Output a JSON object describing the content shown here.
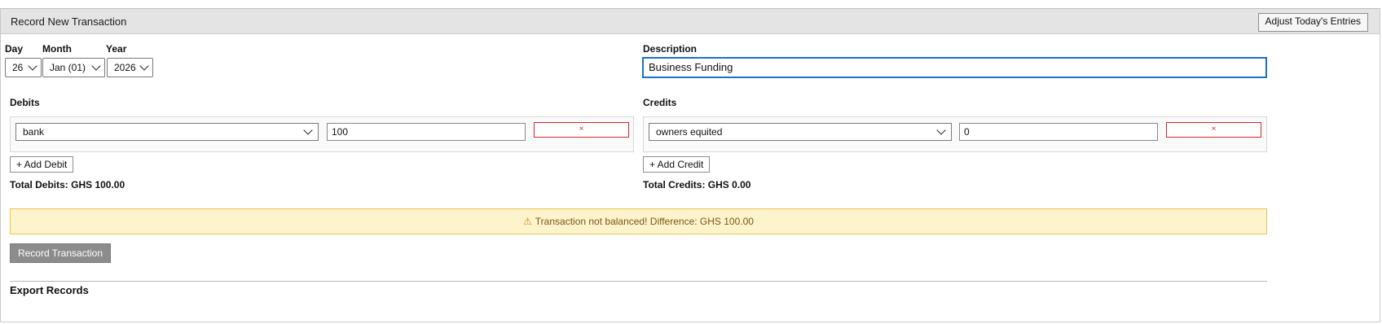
{
  "panel": {
    "title": "Record New Transaction",
    "adjust_button": "Adjust Today's Entries"
  },
  "date": {
    "day_label": "Day",
    "month_label": "Month",
    "year_label": "Year",
    "day_value": "26",
    "month_value": "Jan (01)",
    "year_value": "2026"
  },
  "description": {
    "label": "Description",
    "value": "Business Funding"
  },
  "debits": {
    "title": "Debits",
    "entries": [
      {
        "account": "bank",
        "amount": "100",
        "remove_symbol": "×"
      }
    ],
    "add_button": "+ Add Debit",
    "total": "Total Debits: GHS 100.00"
  },
  "credits": {
    "title": "Credits",
    "entries": [
      {
        "account": "owners equited",
        "amount": "0",
        "remove_symbol": "×"
      }
    ],
    "add_button": "+ Add Credit",
    "total": "Total Credits: GHS 0.00"
  },
  "warning": {
    "icon": "warning-icon",
    "symbol": "⚠",
    "text": "Transaction not balanced! Difference: GHS 100.00"
  },
  "record_button": "Record Transaction",
  "export": {
    "title": "Export Records"
  },
  "colors": {
    "header_bg": "#e4e4e4",
    "focus_border": "#1f6fc7",
    "remove_red": "#d9262c",
    "warning_bg": "#fdf3cc",
    "warning_border": "#e6c64a",
    "disabled_button": "#8c8c8c"
  }
}
